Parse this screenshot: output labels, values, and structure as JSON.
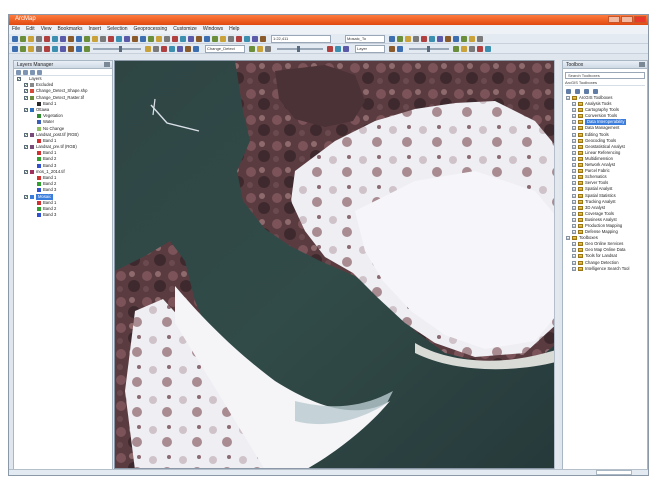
{
  "window": {
    "title": "ArcMap"
  },
  "menu": [
    "File",
    "Edit",
    "View",
    "Bookmarks",
    "Insert",
    "Selection",
    "Geoprocessing",
    "Customize",
    "Windows",
    "Help"
  ],
  "toolbar": {
    "scale_value": "1:22,411",
    "layer_combo": "Change_Detect",
    "editor_combo": "Mosaic_To",
    "small_combo": "Layer"
  },
  "toc": {
    "title": "Layers Manager",
    "rows": [
      {
        "label": "Layers",
        "indent": 0,
        "kind": "group",
        "checked": true
      },
      {
        "label": "Excluded",
        "indent": 1,
        "kind": "layer",
        "checked": true,
        "swatch": "#888888"
      },
      {
        "label": "Change_Detect_Shape.shp",
        "indent": 1,
        "kind": "layer",
        "checked": true,
        "swatch": "#d64a3a"
      },
      {
        "label": "Change_Detect_Raster.tif",
        "indent": 1,
        "kind": "layer",
        "checked": true,
        "swatch": "#6b8c3a"
      },
      {
        "label": "Band 1",
        "indent": 2,
        "kind": "class",
        "checked": false,
        "swatch": "#2a2a2a"
      },
      {
        "label": "Ottawa",
        "indent": 1,
        "kind": "layer",
        "checked": true,
        "swatch": "#2d6fbf"
      },
      {
        "label": "Vegetation",
        "indent": 2,
        "kind": "class",
        "checked": false,
        "swatch": "#2e8b2e"
      },
      {
        "label": "Water",
        "indent": 2,
        "kind": "class",
        "checked": false,
        "swatch": "#3b5fb8"
      },
      {
        "label": "No Change",
        "indent": 2,
        "kind": "class",
        "checked": false,
        "swatch": "#8fc060"
      },
      {
        "label": "Landsat_post.tif (RGB)",
        "indent": 1,
        "kind": "layer",
        "checked": true,
        "swatch": "#7a4a7a"
      },
      {
        "label": "Band 1",
        "indent": 2,
        "kind": "class",
        "checked": false,
        "swatch": "#d03030"
      },
      {
        "label": "Landsat_pre.tif (RGB)",
        "indent": 1,
        "kind": "layer",
        "checked": true,
        "swatch": "#7a4a7a"
      },
      {
        "label": "Band 1",
        "indent": 2,
        "kind": "class",
        "checked": false,
        "swatch": "#d03030"
      },
      {
        "label": "Band 2",
        "indent": 2,
        "kind": "class",
        "checked": false,
        "swatch": "#30a030"
      },
      {
        "label": "Band 3",
        "indent": 2,
        "kind": "class",
        "checked": false,
        "swatch": "#3050d0"
      },
      {
        "label": "mos_1_2014.tif",
        "indent": 1,
        "kind": "layer",
        "checked": true,
        "swatch": "#a03060"
      },
      {
        "label": "Band 1",
        "indent": 2,
        "kind": "class",
        "checked": false,
        "swatch": "#d03030"
      },
      {
        "label": "Band 2",
        "indent": 2,
        "kind": "class",
        "checked": false,
        "swatch": "#30a030"
      },
      {
        "label": "Band 3",
        "indent": 2,
        "kind": "class",
        "checked": false,
        "swatch": "#3050d0"
      },
      {
        "label": "Mosaic",
        "indent": 1,
        "kind": "layer",
        "checked": true,
        "swatch": "#3b7ddd",
        "selected": true
      },
      {
        "label": "Band 1",
        "indent": 2,
        "kind": "class",
        "checked": false,
        "swatch": "#d03030"
      },
      {
        "label": "Band 2",
        "indent": 2,
        "kind": "class",
        "checked": false,
        "swatch": "#30a030"
      },
      {
        "label": "Band 3",
        "indent": 2,
        "kind": "class",
        "checked": false,
        "swatch": "#3050d0"
      }
    ]
  },
  "catalog": {
    "title": "Toolbox",
    "search_label": "Search Toolboxes",
    "subheader": "ArcGIS Toolboxes",
    "rows": [
      {
        "label": "ArcGIS Toolboxes",
        "indent": 0
      },
      {
        "label": "Analysis Tools",
        "indent": 1
      },
      {
        "label": "Cartography Tools",
        "indent": 1
      },
      {
        "label": "Conversion Tools",
        "indent": 1
      },
      {
        "label": "Data Interoperability",
        "indent": 1,
        "selected": true
      },
      {
        "label": "Data Management",
        "indent": 1
      },
      {
        "label": "Editing Tools",
        "indent": 1
      },
      {
        "label": "Geocoding Tools",
        "indent": 1
      },
      {
        "label": "Geostatistical Analyst",
        "indent": 1
      },
      {
        "label": "Linear Referencing",
        "indent": 1
      },
      {
        "label": "Multidimension",
        "indent": 1
      },
      {
        "label": "Network Analyst",
        "indent": 1
      },
      {
        "label": "Parcel Fabric",
        "indent": 1
      },
      {
        "label": "Schematics",
        "indent": 1
      },
      {
        "label": "Server Tools",
        "indent": 1
      },
      {
        "label": "Spatial Analyst",
        "indent": 1
      },
      {
        "label": "Spatial Statistics",
        "indent": 1
      },
      {
        "label": "Tracking Analyst",
        "indent": 1
      },
      {
        "label": "3D Analyst",
        "indent": 1
      },
      {
        "label": "Coverage Tools",
        "indent": 1
      },
      {
        "label": "Business Analyst",
        "indent": 1
      },
      {
        "label": "Production Mapping",
        "indent": 1
      },
      {
        "label": "Defense Mapping",
        "indent": 1
      },
      {
        "label": "Toolboxes",
        "indent": 0
      },
      {
        "label": "Geo Online Services",
        "indent": 1
      },
      {
        "label": "Geo Map Online Data",
        "indent": 1
      },
      {
        "label": "Tools for Landsat",
        "indent": 1
      },
      {
        "label": "Change Detection",
        "indent": 1
      },
      {
        "label": "Intelligence Search Tool",
        "indent": 1
      }
    ]
  },
  "status": {
    "coords": ""
  }
}
